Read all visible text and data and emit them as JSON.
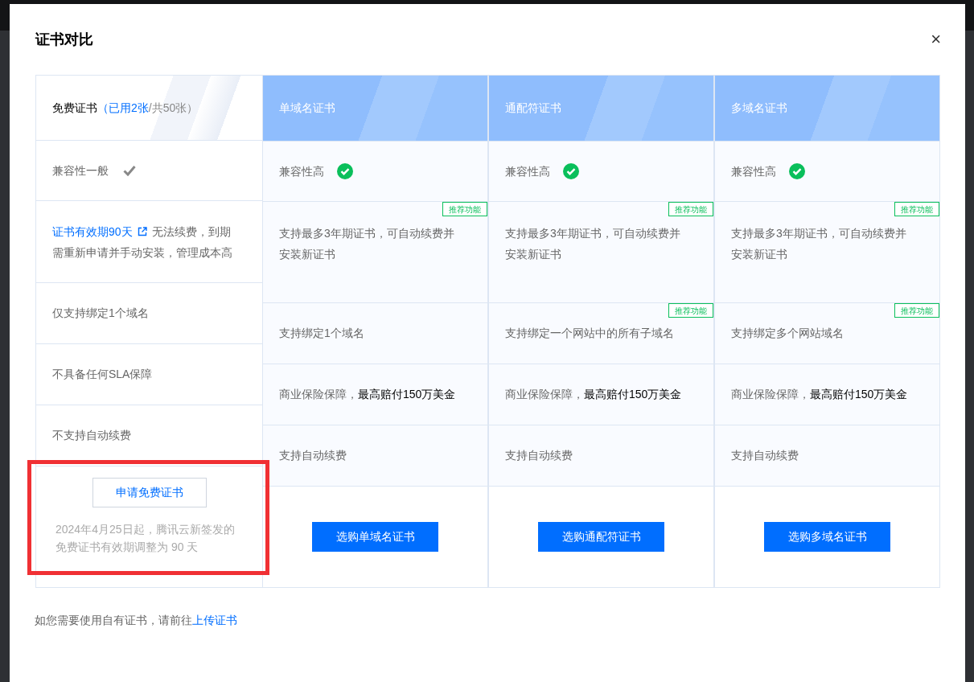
{
  "dialog": {
    "title": "证书对比",
    "close": "×"
  },
  "free_column": {
    "title": "免费证书",
    "used": "（已用2张",
    "total": "/共50张）",
    "rows": [
      {
        "kind": "compat",
        "text": "兼容性一般",
        "high": false
      },
      {
        "kind": "validity",
        "link": "证书有效期90天",
        "text": "无法续费，到期需重新申请并手动安装，管理成本高"
      },
      {
        "kind": "plain",
        "text": "仅支持绑定1个域名"
      },
      {
        "kind": "plain",
        "text": "不具备任何SLA保障"
      },
      {
        "kind": "plain",
        "text": "不支持自动续费"
      }
    ],
    "button": "申请免费证书",
    "note": "2024年4月25日起，腾讯云新签发的免费证书有效期调整为 90 天"
  },
  "paid_columns": [
    {
      "title": "单域名证书",
      "rows": [
        {
          "kind": "compat",
          "text": "兼容性高",
          "high": true
        },
        {
          "kind": "tall",
          "text": "支持最多3年期证书，可自动续费并安装新证书",
          "badge": "推荐功能"
        },
        {
          "kind": "plain",
          "text": "支持绑定1个域名"
        },
        {
          "kind": "plain",
          "text": "商业保险保障，**最高赔付150万美金**"
        },
        {
          "kind": "plain",
          "text": "支持自动续费"
        }
      ],
      "button": "选购单域名证书"
    },
    {
      "title": "通配符证书",
      "rows": [
        {
          "kind": "compat",
          "text": "兼容性高",
          "high": true
        },
        {
          "kind": "tall",
          "text": "支持最多3年期证书，可自动续费并安装新证书",
          "badge": "推荐功能"
        },
        {
          "kind": "plain",
          "text": "支持绑定一个网站中的所有子域名",
          "badge": "推荐功能"
        },
        {
          "kind": "plain",
          "text": "商业保险保障，**最高赔付150万美金**"
        },
        {
          "kind": "plain",
          "text": "支持自动续费"
        }
      ],
      "button": "选购通配符证书"
    },
    {
      "title": "多域名证书",
      "rows": [
        {
          "kind": "compat",
          "text": "兼容性高",
          "high": true
        },
        {
          "kind": "tall",
          "text": "支持最多3年期证书，可自动续费并安装新证书",
          "badge": "推荐功能"
        },
        {
          "kind": "plain",
          "text": "支持绑定多个网站域名",
          "badge": "推荐功能"
        },
        {
          "kind": "plain",
          "text": "商业保险保障，**最高赔付150万美金**"
        },
        {
          "kind": "plain",
          "text": "支持自动续费"
        }
      ],
      "button": "选购多域名证书"
    }
  ],
  "footer": {
    "text": "如您需要使用自有证书，请前往",
    "link": "上传证书"
  }
}
